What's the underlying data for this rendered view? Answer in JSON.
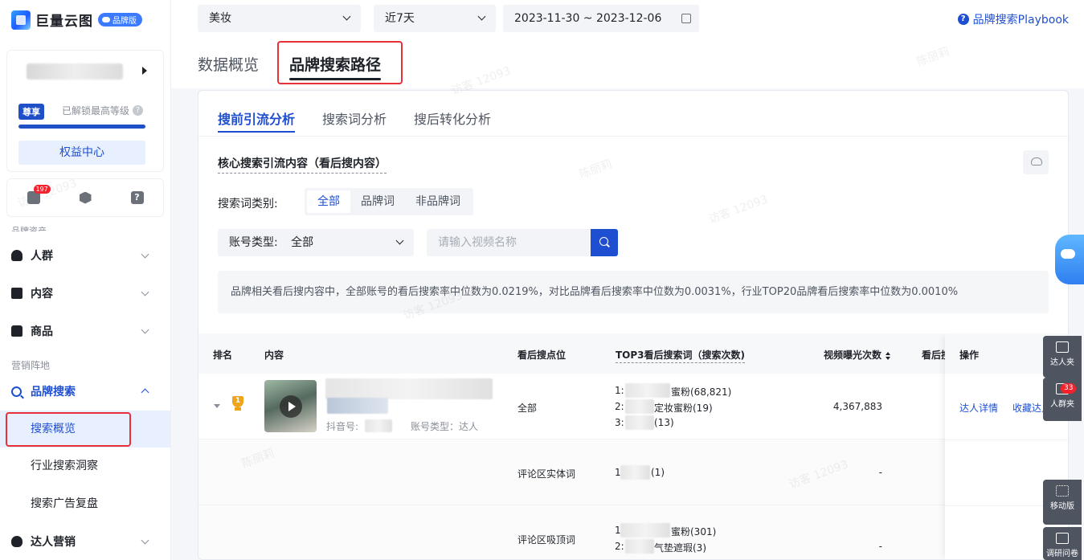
{
  "app": {
    "name": "巨量云图",
    "edition": "品牌版"
  },
  "sidebar": {
    "vip_tag": "尊享",
    "vip_desc": "已解锁最高等级",
    "vip_help": "?",
    "rights_button": "权益中心",
    "message_badge": "197",
    "help_icon": "?",
    "cut_label": "品牌资产",
    "nav": [
      {
        "label": "人群",
        "icon": "person-icon"
      },
      {
        "label": "内容",
        "icon": "content-icon"
      },
      {
        "label": "商品",
        "icon": "bag-icon"
      }
    ],
    "group_label": "营销阵地",
    "brand_search": "品牌搜索",
    "sub_items": [
      "搜索概览",
      "行业搜索洞察",
      "搜索广告复盘"
    ],
    "talent_marketing": "达人营销"
  },
  "topbar": {
    "industry": "美妆",
    "period": "近7天",
    "date_range": "2023-11-30 ~ 2023-12-06",
    "playbook_icon": "?",
    "playbook": "品牌搜索Playbook"
  },
  "page_tabs": [
    "数据概览",
    "品牌搜索路径"
  ],
  "sub_tabs": [
    "搜前引流分析",
    "搜索词分析",
    "搜后转化分析"
  ],
  "section_title": "核心搜索引流内容（看后搜内容）",
  "filters": {
    "keyword_type_label": "搜索词类别:",
    "keyword_types": [
      "全部",
      "品牌词",
      "非品牌词"
    ],
    "account_type_label": "账号类型:",
    "account_type_value": "全部",
    "search_placeholder": "请输入视频名称"
  },
  "info_text": "品牌相关看后搜内容中，全部账号的看后搜索率中位数为0.0219%，对比品牌看后搜索率中位数为0.0031%，行业TOP20品牌看后搜索率中位数为0.0010%",
  "table": {
    "headers": {
      "rank": "排名",
      "content": "内容",
      "point": "看后搜点位",
      "top3": "TOP3看后搜索词（搜索次数)",
      "views": "视频曝光次数",
      "rate": "看后搜",
      "ops": "操作"
    },
    "douyin_label": "抖音号:",
    "account_label": "账号类型：达人",
    "rows": [
      {
        "point": "全部",
        "keywords": [
          "1:",
          "蜜粉(68,821)",
          "2:",
          "定妆蜜粉(19)",
          "3:",
          "(13)"
        ],
        "views": "4,367,883",
        "ops": [
          "达人详情",
          "收藏达人"
        ]
      },
      {
        "point": "评论区实体词",
        "keywords": [
          "1",
          "(1)"
        ],
        "views": "-"
      },
      {
        "point": "评论区吸顶词",
        "keywords": [
          "1",
          "蜜粉(301)",
          "2:",
          "气垫遮瑕(3)"
        ],
        "views": "-"
      }
    ]
  },
  "float_tools": [
    {
      "label": "达人夹"
    },
    {
      "label": "人群夹",
      "badge": "33"
    },
    {
      "label": "移动版"
    },
    {
      "label": "调研问卷"
    }
  ],
  "watermark": "访客 12093",
  "watermark_name": "陈丽莉"
}
